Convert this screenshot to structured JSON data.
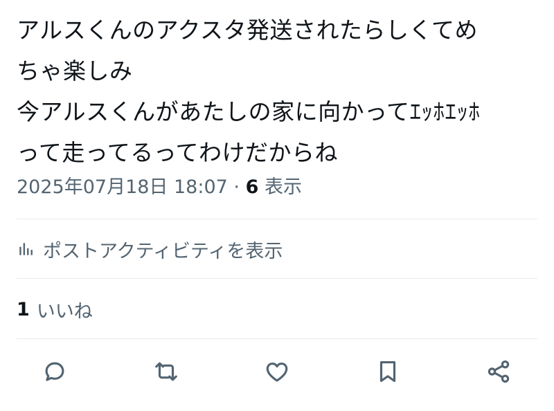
{
  "tweet": {
    "lines": [
      "アルスくんのアクスタ発送されたらしくてめ",
      "ちゃ楽しみ",
      "今アルスくんがあたしの家に向かってｴｯﾎｴｯﾎ",
      "って走ってるってわけだからね"
    ]
  },
  "meta": {
    "timestamp": "2025年07月18日 18:07",
    "separator": "·",
    "views_count": "6",
    "views_label": "表示"
  },
  "activity": {
    "label": "ポストアクティビティを表示",
    "icon": "analytics-icon"
  },
  "likes": {
    "count": "1",
    "label": "いいね"
  },
  "actions": {
    "reply_icon": "reply-icon",
    "repost_icon": "repost-icon",
    "like_icon": "like-icon",
    "bookmark_icon": "bookmark-icon",
    "share_icon": "share-icon",
    "icon_color": "#536471"
  },
  "colors": {
    "text": "#0f1419",
    "secondary": "#536471",
    "divider": "#e6e9ec"
  }
}
